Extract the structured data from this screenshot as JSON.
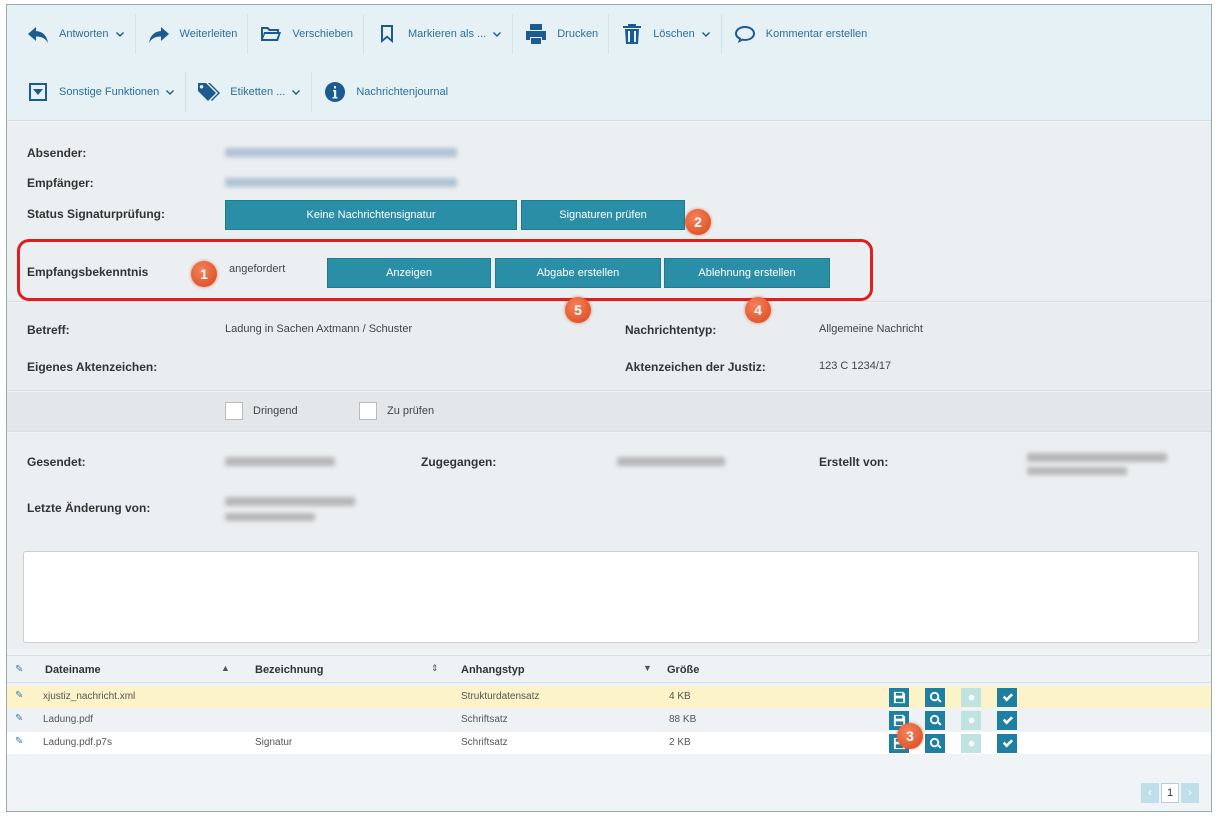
{
  "toolbar": {
    "row1": [
      {
        "label": "Antworten",
        "icon": "reply-icon",
        "dropdown": true
      },
      {
        "label": "Weiterleiten",
        "icon": "forward-icon",
        "dropdown": false
      },
      {
        "label": "Verschieben",
        "icon": "folder-icon",
        "dropdown": false
      },
      {
        "label": "Markieren als ...",
        "icon": "bookmark-icon",
        "dropdown": true
      },
      {
        "label": "Drucken",
        "icon": "printer-icon",
        "dropdown": false
      },
      {
        "label": "Löschen",
        "icon": "trash-icon",
        "dropdown": true
      },
      {
        "label": "Kommentar erstellen",
        "icon": "comment-icon",
        "dropdown": false
      }
    ],
    "row2": [
      {
        "label": "Sonstige Funktionen",
        "icon": "dropdown-box-icon",
        "dropdown": true
      },
      {
        "label": "Etiketten ...",
        "icon": "tags-icon",
        "dropdown": true
      },
      {
        "label": "Nachrichtenjournal",
        "icon": "info-icon",
        "dropdown": false
      }
    ]
  },
  "header": {
    "sender_label": "Absender:",
    "recipient_label": "Empfänger:",
    "signature_label": "Status Signaturprüfung:",
    "signature_status_button": "Keine Nachrichtensignatur",
    "check_signatures_button": "Signaturen prüfen"
  },
  "receipt": {
    "label": "Empfangsbekenntnis",
    "status": "angefordert",
    "show_button": "Anzeigen",
    "submit_button": "Abgabe erstellen",
    "reject_button": "Ablehnung erstellen"
  },
  "badges": {
    "b1": "1",
    "b2": "2",
    "b3": "3",
    "b4": "4",
    "b5": "5"
  },
  "details": {
    "subject_label": "Betreff:",
    "subject_value": "Ladung in Sachen Axtmann / Schuster",
    "own_ref_label": "Eigenes Aktenzeichen:",
    "msg_type_label": "Nachrichtentyp:",
    "msg_type_value": "Allgemeine Nachricht",
    "court_ref_label": "Aktenzeichen der Justiz:",
    "court_ref_value": "123 C 1234/17"
  },
  "flags": {
    "urgent": "Dringend",
    "to_check": "Zu prüfen"
  },
  "meta": {
    "sent_label": "Gesendet:",
    "received_label": "Zugegangen:",
    "created_by_label": "Erstellt von:",
    "last_change_label": "Letzte Änderung von:"
  },
  "table": {
    "columns": [
      "Dateiname",
      "Bezeichnung",
      "Anhangstyp",
      "Größe"
    ],
    "rows": [
      {
        "file": "xjustiz_nachricht.xml",
        "desc": "",
        "type": "Strukturdatensatz",
        "size": "4 KB",
        "highlight": "#fdf3c8"
      },
      {
        "file": "Ladung.pdf",
        "desc": "",
        "type": "Schriftsatz",
        "size": "88 KB",
        "highlight": "#eef2f4"
      },
      {
        "file": "Ladung.pdf.p7s",
        "desc": "Signatur",
        "type": "Schriftsatz",
        "size": "2 KB",
        "highlight": "#ffffff"
      }
    ]
  },
  "pager": {
    "current": "1"
  }
}
